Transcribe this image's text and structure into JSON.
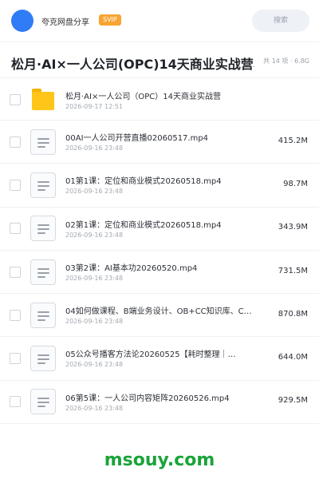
{
  "header": {
    "app_name": "夸克网盘分享",
    "badge": "SVIP",
    "search_label": "搜索"
  },
  "title_bar": {
    "title": "松月·AI×一人公司(OPC)14天商业实战营、",
    "count_info": "共 14 项 · 6.8G"
  },
  "files": [
    {
      "type": "folder",
      "name": "松月·AI×一人公司（OPC）14天商业实战营",
      "date": "2026-09-17 12:51",
      "size": ""
    },
    {
      "type": "video",
      "name": "00AI一人公司开营直播02060517.mp4",
      "date": "2026-09-16 23:48",
      "size": "415.2M"
    },
    {
      "type": "video",
      "name": "01第1课：定位和商业模式20260518.mp4",
      "date": "2026-09-16 23:48",
      "size": "98.7M"
    },
    {
      "type": "video",
      "name": "02第1课：定位和商业模式20260518.mp4",
      "date": "2026-09-16 23:48",
      "size": "343.9M"
    },
    {
      "type": "video",
      "name": "03第2课：AI基本功20260520.mp4",
      "date": "2026-09-16 23:48",
      "size": "731.5M"
    },
    {
      "type": "video",
      "name": "04如何做课程、B端业务设计、OB+CC知识库、C…",
      "date": "2026-09-16 23:48",
      "size": "870.8M"
    },
    {
      "type": "video",
      "name": "05公众号播客方法论20260525【耗时整理｜…",
      "date": "2026-09-16 23:48",
      "size": "644.0M"
    },
    {
      "type": "video",
      "name": "06第5课：一人公司内容矩阵20260526.mp4",
      "date": "2026-09-16 23:48",
      "size": "929.5M"
    }
  ],
  "watermark": "msouy.com",
  "colors": {
    "avatar": "#2f7cf6",
    "badge": "#f6a533",
    "folder": "#ffc519",
    "watermark": "#1aa33a"
  }
}
